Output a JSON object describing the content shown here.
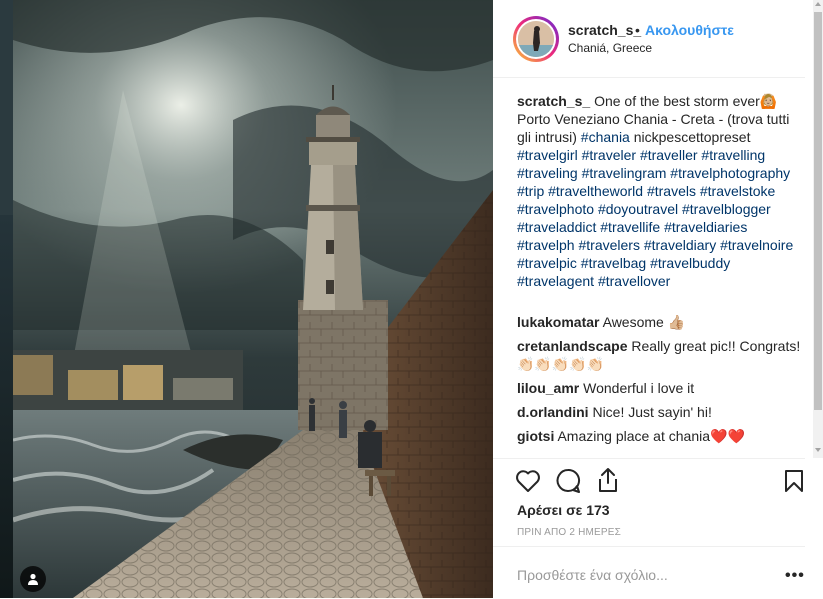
{
  "post": {
    "username": "scratch_s_",
    "dot": "•",
    "follow_label": "Ακολουθήστε",
    "location": "Chaniá, Greece"
  },
  "caption": {
    "username": "scratch_s_",
    "text": "One of the best storm ever",
    "emoji": "🙆🏼",
    "text2": "Porto Veneziano Chania - Creta - (trova tutti gli intrusi)",
    "hashtag_chania": "#chania",
    "text3": "nickpescettopreset",
    "hashtags": "#travelgirl #traveler #traveller #travelling #traveling #travelingram #travelphotography #trip #traveltheworld #travels #travelstoke #travelphoto #doyoutravel #travelblogger #traveladdict #travellife #traveldiaries #travelph #travelers #traveldiary #travelnoire #travelpic #travelbag #travelbuddy #travelagent #travellover"
  },
  "comments": [
    {
      "user": "lukakomatar",
      "text": "Awesome 👍🏼"
    },
    {
      "user": "cretanlandscape",
      "text": "Really great pic!! Congrats! 👏🏻👏🏻👏🏻👏🏻👏🏻"
    },
    {
      "user": "lilou_amr",
      "text": "Wonderful i love it"
    },
    {
      "user": "d.orlandini",
      "text": "Nice! Just sayin' hi!"
    },
    {
      "user": "giotsi",
      "text": "Amazing place at chania❤️❤️"
    }
  ],
  "actions": {
    "likes": "Αρέσει σε 173",
    "time": "ΠΡΙΝ ΑΠΟ 2 ΗΜΕΡΕΣ"
  },
  "add_comment": {
    "placeholder": "Προσθέστε ένα σχόλιο...",
    "more": "•••"
  },
  "icons": [
    "heart-icon",
    "comment-icon",
    "share-icon",
    "bookmark-icon",
    "user-tag-icon"
  ],
  "colors": {
    "link": "#3897f0",
    "hashtag": "#003569",
    "muted": "#999999",
    "border": "#efefef"
  }
}
